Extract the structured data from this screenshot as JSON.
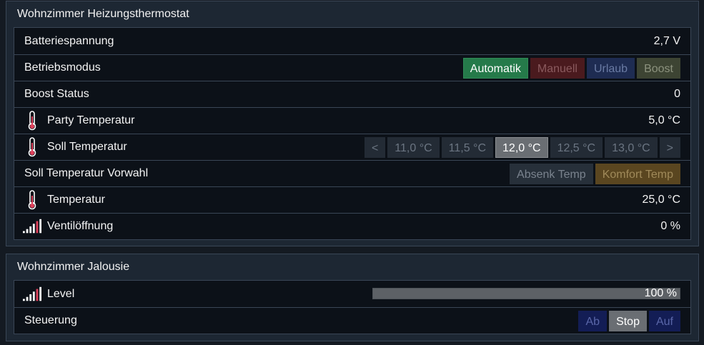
{
  "heizung": {
    "title": "Wohnzimmer Heizungsthermostat",
    "rows": {
      "batterie": {
        "label": "Batteriespannung",
        "value": "2,7 V"
      },
      "betriebsmodus": {
        "label": "Betriebsmodus",
        "buttons": [
          "Automatik",
          "Manuell",
          "Urlaub",
          "Boost"
        ],
        "selected": "Automatik"
      },
      "boost_status": {
        "label": "Boost Status",
        "value": "0"
      },
      "party": {
        "label": "Party Temperatur",
        "value": "5,0 °C",
        "icon": "thermometer-icon"
      },
      "soll": {
        "label": "Soll Temperatur",
        "icon": "thermometer-icon",
        "prev": "<",
        "next": ">",
        "options": [
          "11,0 °C",
          "11,5 °C",
          "12,0 °C",
          "12,5 °C",
          "13,0 °C"
        ],
        "selected": "12,0 °C"
      },
      "vorwahl": {
        "label": "Soll Temperatur Vorwahl",
        "buttons": [
          "Absenk Temp",
          "Komfort Temp"
        ]
      },
      "temperatur": {
        "label": "Temperatur",
        "value": "25,0 °C",
        "icon": "thermometer-icon"
      },
      "ventil": {
        "label": "Ventilöffnung",
        "value": "0 %",
        "icon": "signal-bars-icon"
      }
    }
  },
  "jalousie": {
    "title": "Wohnzimmer Jalousie",
    "rows": {
      "level": {
        "label": "Level",
        "value": "100 %",
        "fraction": 1.0,
        "icon": "signal-bars-icon"
      },
      "steuerung": {
        "label": "Steuerung",
        "buttons": [
          "Ab",
          "Stop",
          "Auf"
        ],
        "selected": "Stop"
      }
    }
  },
  "colors": {
    "accent_green": "#257a4a",
    "background": "#141a22",
    "panel": "#1d2733"
  }
}
